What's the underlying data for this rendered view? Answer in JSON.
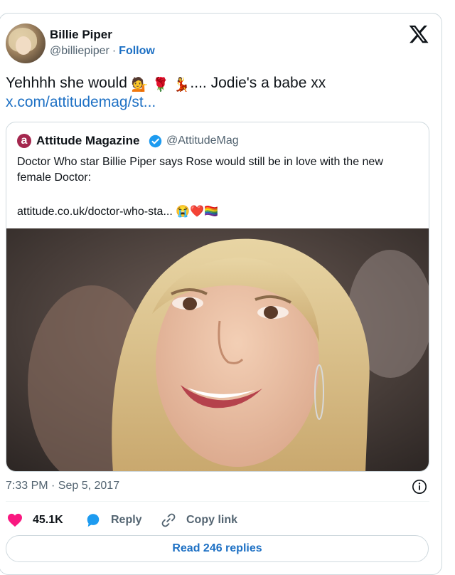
{
  "tweet": {
    "author_name": "Billie Piper",
    "author_handle": "@billiepiper",
    "follow_label": "Follow",
    "text": "Yehhhh she would",
    "emojis": [
      "💁",
      "🌹",
      "💃"
    ],
    "text_tail": ".... Jodie's a babe xx",
    "link": "x.com/attitudemag/st...",
    "timestamp": "7:33 PM · Sep 5, 2017",
    "likes": "45.1K",
    "reply_label": "Reply",
    "copy_link_label": "Copy link",
    "read_replies_label": "Read 246 replies"
  },
  "quoted": {
    "author_name": "Attitude Magazine",
    "author_handle": "@AttitudeMag",
    "logo_letter": "a",
    "text": "Doctor Who star Billie Piper says Rose would still be in love with the new female Doctor:",
    "url": "attitude.co.uk/doctor-who-sta...",
    "url_emojis": "😭❤️🏳️‍🌈"
  },
  "colors": {
    "link_blue": "#1d70c4",
    "like_pink": "#f91880",
    "muted_gray": "#536471",
    "border": "#cfd9de",
    "verified_blue": "#1d9bf0"
  }
}
